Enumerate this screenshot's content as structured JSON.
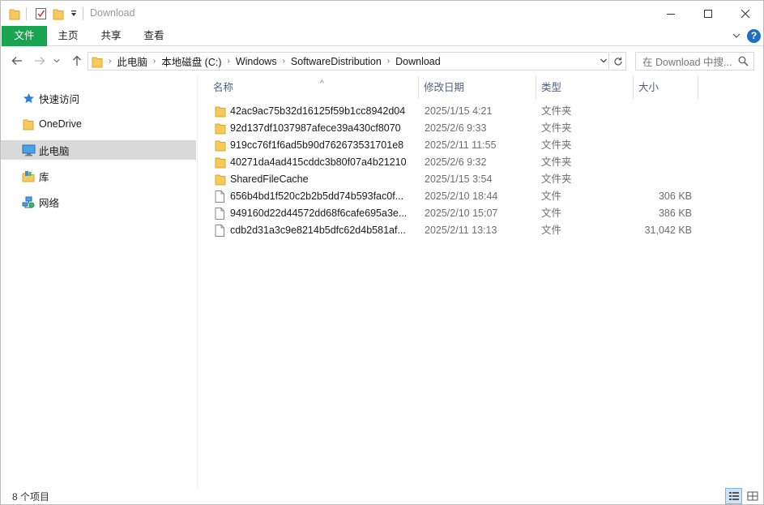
{
  "window": {
    "title": "Download",
    "controls": {
      "minimize": "minimize-icon",
      "maximize": "maximize-icon",
      "close": "close-icon"
    }
  },
  "ribbon": {
    "tabs": [
      "文件",
      "主页",
      "共享",
      "查看"
    ]
  },
  "address": {
    "crumbs": [
      "此电脑",
      "本地磁盘 (C:)",
      "Windows",
      "SoftwareDistribution",
      "Download"
    ],
    "search_placeholder": "在 Download 中搜..."
  },
  "sidebar": {
    "items": [
      {
        "label": "快速访问",
        "icon": "star-icon"
      },
      {
        "label": "OneDrive",
        "icon": "folder-icon"
      },
      {
        "label": "此电脑",
        "icon": "computer-icon",
        "selected": true
      },
      {
        "label": "库",
        "icon": "library-icon"
      },
      {
        "label": "网络",
        "icon": "network-icon"
      }
    ]
  },
  "columns": {
    "name": "名称",
    "date": "修改日期",
    "type": "类型",
    "size": "大小"
  },
  "files": [
    {
      "name": "42ac9ac75b32d16125f59b1cc8942d04",
      "date": "2025/1/15 4:21",
      "type": "文件夹",
      "size": "",
      "kind": "folder"
    },
    {
      "name": "92d137df1037987afece39a430cf8070",
      "date": "2025/2/6 9:33",
      "type": "文件夹",
      "size": "",
      "kind": "folder"
    },
    {
      "name": "919cc76f1f6ad5b90d762673531701e8",
      "date": "2025/2/11 11:55",
      "type": "文件夹",
      "size": "",
      "kind": "folder"
    },
    {
      "name": "40271da4ad415cddc3b80f07a4b21210",
      "date": "2025/2/6 9:32",
      "type": "文件夹",
      "size": "",
      "kind": "folder"
    },
    {
      "name": "SharedFileCache",
      "date": "2025/1/15 3:54",
      "type": "文件夹",
      "size": "",
      "kind": "folder"
    },
    {
      "name": "656b4bd1f520c2b2b5dd74b593fac0f...",
      "date": "2025/2/10 18:44",
      "type": "文件",
      "size": "306 KB",
      "kind": "file"
    },
    {
      "name": "949160d22d44572dd68f6cafe695a3e...",
      "date": "2025/2/10 15:07",
      "type": "文件",
      "size": "386 KB",
      "kind": "file"
    },
    {
      "name": "cdb2d31a3c9e8214b5dfc62d4b581af...",
      "date": "2025/2/11 13:13",
      "type": "文件",
      "size": "31,042 KB",
      "kind": "file"
    }
  ],
  "status": {
    "count": "8 个项目"
  },
  "colors": {
    "accent": "#19a550",
    "header_text": "#4d6082",
    "help": "#1f6fc5",
    "folder": "#f6c95a"
  }
}
